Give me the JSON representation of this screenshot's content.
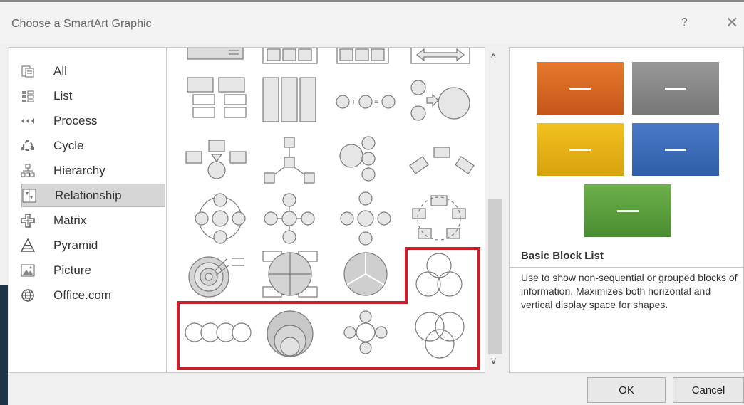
{
  "dialog": {
    "title": "Choose a SmartArt Graphic",
    "help_label": "?",
    "close_label": "✕"
  },
  "sidebar": {
    "items": [
      {
        "label": "All",
        "icon": "all-icon"
      },
      {
        "label": "List",
        "icon": "list-icon"
      },
      {
        "label": "Process",
        "icon": "process-icon"
      },
      {
        "label": "Cycle",
        "icon": "cycle-icon"
      },
      {
        "label": "Hierarchy",
        "icon": "hierarchy-icon"
      },
      {
        "label": "Relationship",
        "icon": "relationship-icon",
        "selected": true
      },
      {
        "label": "Matrix",
        "icon": "matrix-icon"
      },
      {
        "label": "Pyramid",
        "icon": "pyramid-icon"
      },
      {
        "label": "Picture",
        "icon": "picture-icon"
      },
      {
        "label": "Office.com",
        "icon": "globe-icon"
      }
    ]
  },
  "gallery": {
    "scroll_up": "^",
    "scroll_down": "v",
    "highlight_color": "#c8202a"
  },
  "preview": {
    "name": "Basic Block List",
    "description": "Use to show non-sequential or grouped blocks of information. Maximizes both horizontal and vertical display space for shapes.",
    "colors": [
      "#e67a2d",
      "#8c8c8c",
      "#f2c11e",
      "#3f6fbf",
      "#5ea540"
    ]
  },
  "buttons": {
    "ok": "OK",
    "cancel": "Cancel"
  }
}
